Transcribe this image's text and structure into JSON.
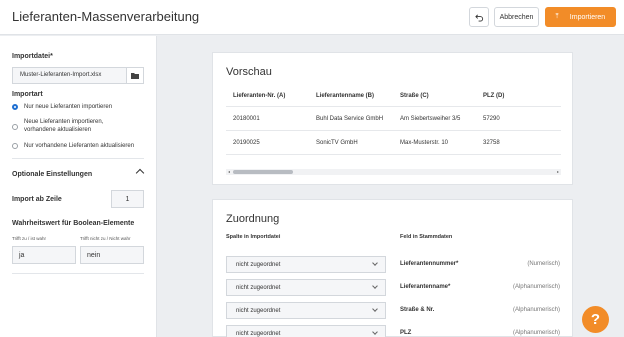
{
  "header": {
    "title": "Lieferanten-Massenverarbeitung",
    "undo_icon": "undo-icon",
    "cancel_label": "Abbrechen",
    "import_label": "Importieren",
    "import_icon": "upload-icon",
    "accent_color": "#f28c28"
  },
  "sidebar": {
    "file_label": "Importdatei*",
    "file_value": "Muster-Lieferanten-Import.xlsx",
    "folder_icon": "folder-icon",
    "import_type_label": "Importart",
    "options": [
      {
        "label": "Nur neue Lieferanten importieren",
        "selected": true
      },
      {
        "label": "Neue Lieferanten importieren,",
        "label2": "vorhandene aktualisieren",
        "selected": false
      },
      {
        "label": "Nur vorhandene Lieferanten aktualisieren",
        "selected": false
      }
    ],
    "optional_label": "Optionale Einstellungen",
    "start_row_label": "Import ab Zeile",
    "start_row_value": "1",
    "boolean_label": "Wahrheitswert für Boolean-Elemente",
    "true_label": "Trifft zu / ist wahr",
    "false_label": "Trifft nicht zu / Nicht wahr",
    "true_value": "ja",
    "false_value": "nein"
  },
  "preview": {
    "title": "Vorschau",
    "columns": [
      "Lieferanten-Nr. (A)",
      "Lieferantenname (B)",
      "Straße (C)",
      "PLZ (D)"
    ],
    "rows": [
      [
        "20180001",
        "Buhl Data Service GmbH",
        "Am Siebertsweiher 3/5",
        "57290"
      ],
      [
        "20190025",
        "SonicTV GmbH",
        "Max-Musterstr. 10",
        "32758"
      ]
    ]
  },
  "mapping": {
    "title": "Zuordnung",
    "col_source": "Spalte in Importdatei",
    "col_target": "Feld in Stammdaten",
    "rows": [
      {
        "select": "nicht zugeordnet",
        "field": "Lieferantennummer*",
        "type": "(Numerisch)"
      },
      {
        "select": "nicht zugeordnet",
        "field": "Lieferantenname*",
        "type": "(Alphanumerisch)"
      },
      {
        "select": "nicht zugeordnet",
        "field": "Straße & Nr.",
        "type": "(Alphanumerisch)"
      },
      {
        "select": "nicht zugeordnet",
        "field": "PLZ",
        "type": "(Alphanumerisch)"
      }
    ]
  },
  "help": {
    "label": "?",
    "icon": "help-icon"
  }
}
